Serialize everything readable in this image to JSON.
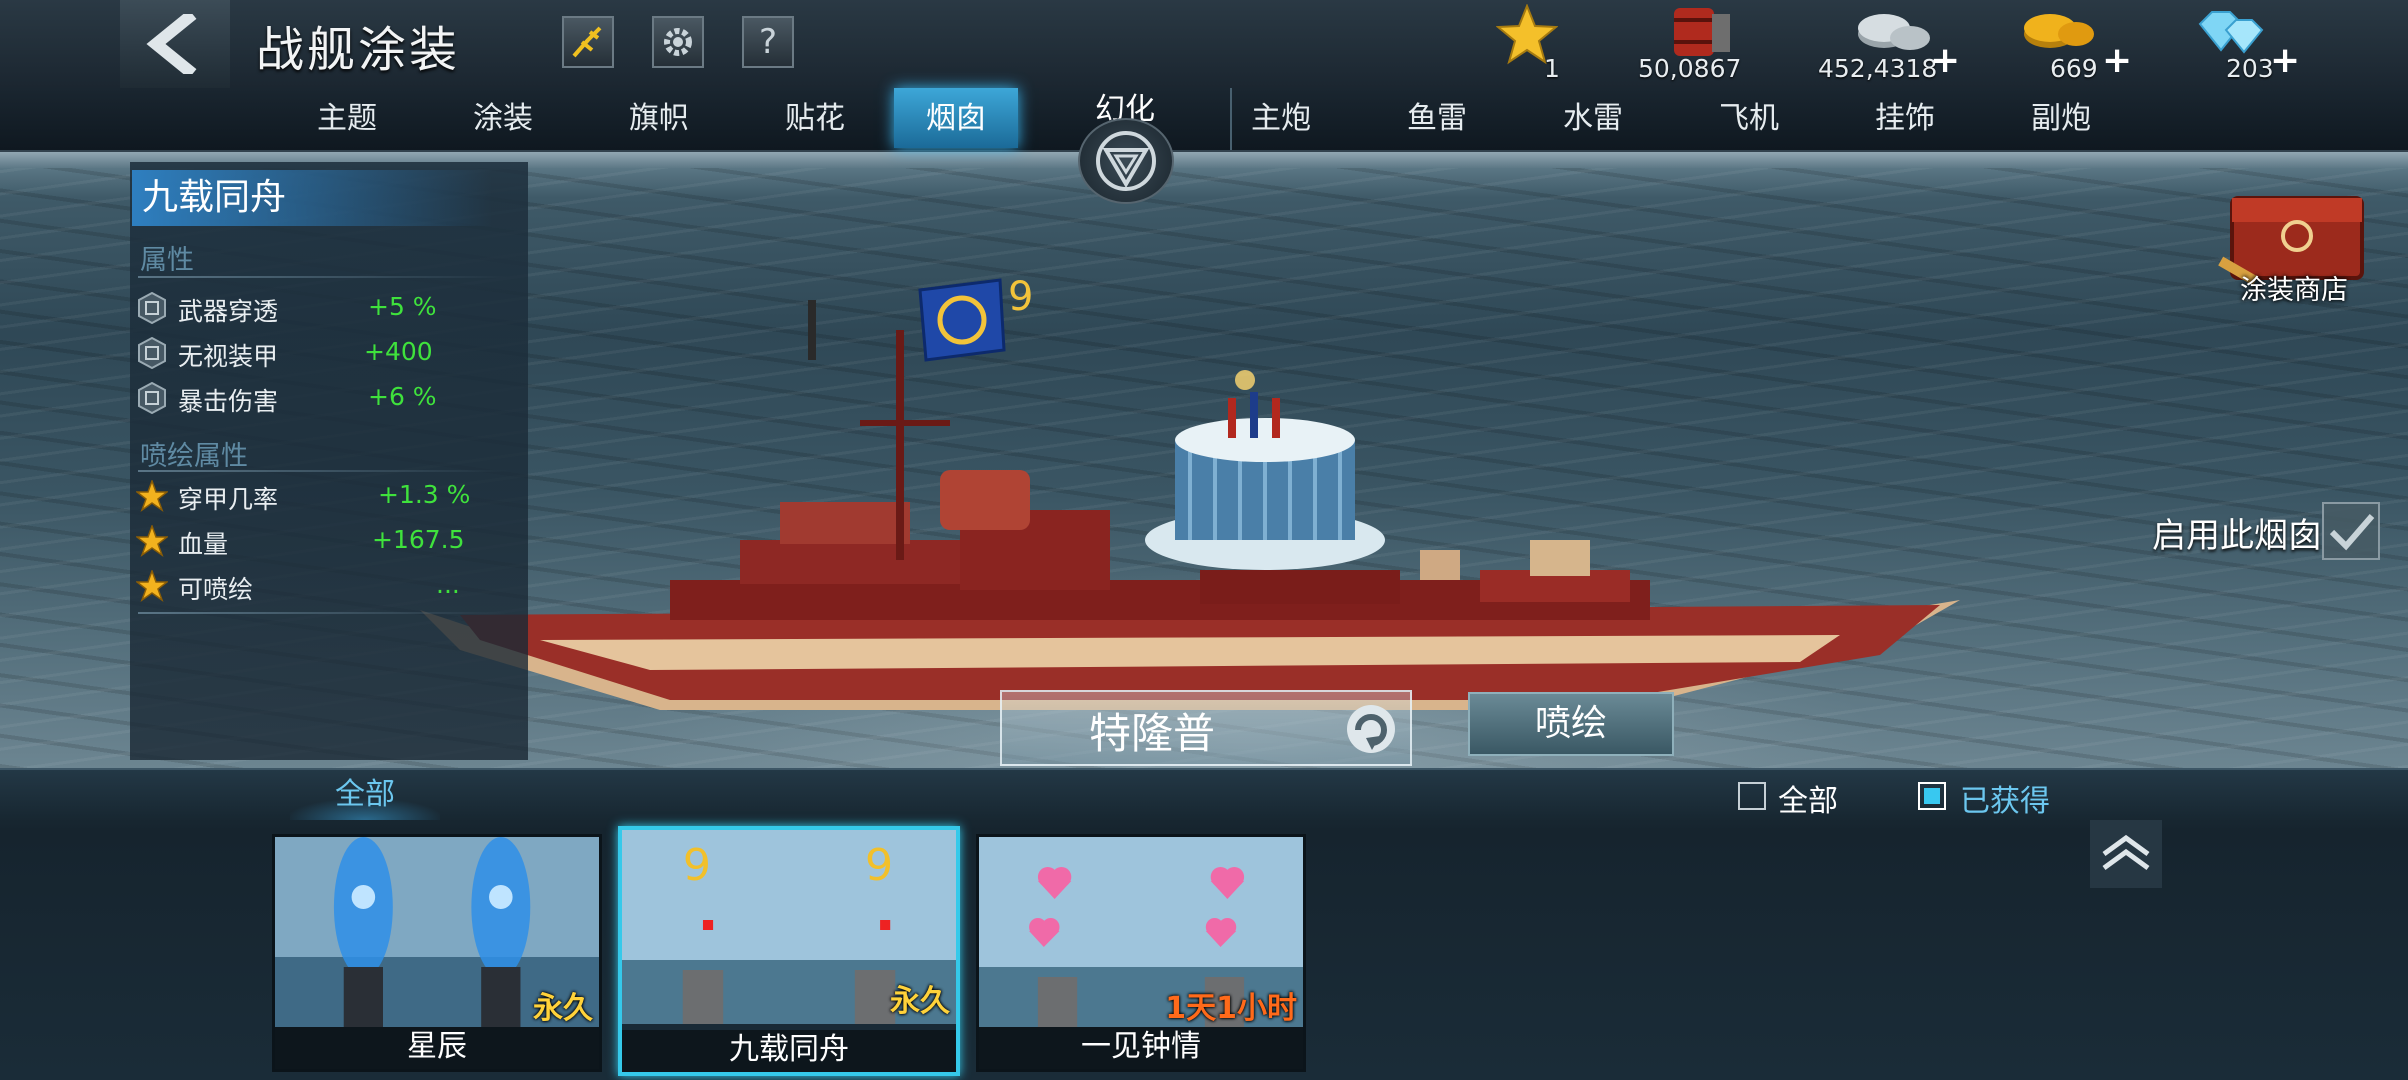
{
  "header": {
    "title": "战舰涂装",
    "resources": [
      {
        "id": "star",
        "value": "1",
        "has_plus": false,
        "color": "#f4c02a"
      },
      {
        "id": "barrel",
        "value": "50,0867",
        "has_plus": false,
        "color": "#b02a1e"
      },
      {
        "id": "silver",
        "value": "452,4318",
        "has_plus": true,
        "color": "#c9d1d6"
      },
      {
        "id": "gold",
        "value": "669",
        "has_plus": true,
        "color": "#f0b21c"
      },
      {
        "id": "diamond",
        "value": "203",
        "has_plus": true,
        "color": "#7fd6f5"
      }
    ],
    "plus": "+",
    "help": "?"
  },
  "tabs": {
    "left": [
      "主题",
      "涂装",
      "旗帜",
      "贴花",
      "烟囱"
    ],
    "active": "烟囱",
    "magic": "幻化",
    "right": [
      "主炮",
      "鱼雷",
      "水雷",
      "飞机",
      "挂饰",
      "副炮"
    ]
  },
  "panel": {
    "skin_name": "九载同舟",
    "attr_title": "属性",
    "attrs": [
      {
        "name": "武器穿透",
        "value": "+5 %"
      },
      {
        "name": "无视装甲",
        "value": "+400"
      },
      {
        "name": "暴击伤害",
        "value": "+6 %"
      }
    ],
    "spray_title": "喷绘属性",
    "spray_attrs": [
      {
        "name": "穿甲几率",
        "value": "+1.3 %"
      },
      {
        "name": "血量",
        "value": "+167.5"
      },
      {
        "name": "可喷绘",
        "value": "..."
      }
    ]
  },
  "ship": {
    "name": "特隆普",
    "paint_label": "喷绘"
  },
  "enable_label": "启用此烟囱",
  "shop_label": "涂装商店",
  "filter": {
    "tab_all": "全部",
    "options": [
      {
        "label": "全部",
        "checked": false
      },
      {
        "label": "已获得",
        "checked": true
      }
    ]
  },
  "items": [
    {
      "name": "星辰",
      "duration": "永久",
      "icon": "blue-smoke"
    },
    {
      "name": "九载同舟",
      "duration": "永久",
      "icon": "number-nine-smoke",
      "selected": true
    },
    {
      "name": "一见钟情",
      "duration": "1天1小时",
      "icon": "heart-smoke"
    }
  ]
}
